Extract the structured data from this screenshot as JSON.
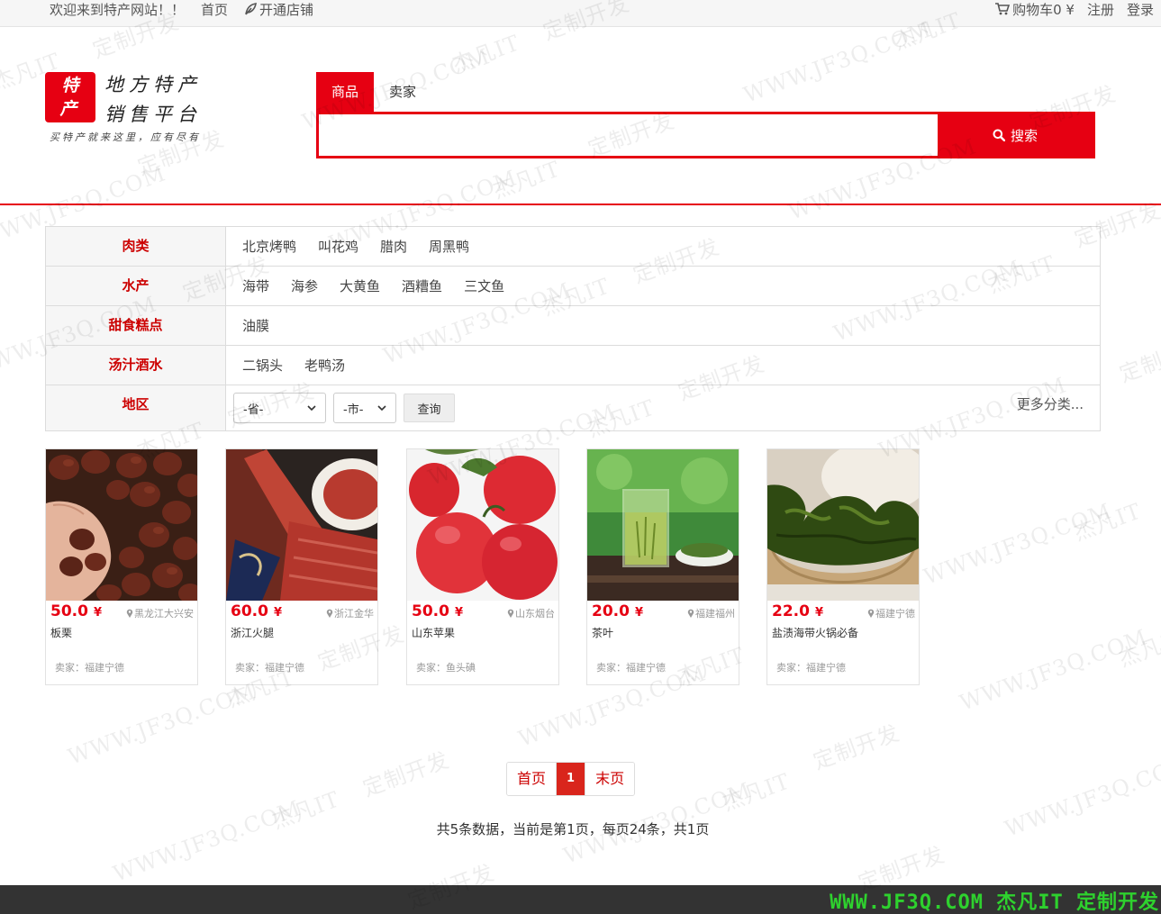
{
  "topbar": {
    "welcome": "欢迎来到特产网站！！",
    "home": "首页",
    "open_shop": "开通店铺",
    "cart": "购物车0 ¥",
    "register": "注册",
    "login": "登录"
  },
  "logo": {
    "char1": "特",
    "char2": "产",
    "line1": "地方特产",
    "line2": "销售平台",
    "slogan": "买特产就来这里，应有尽有"
  },
  "search": {
    "tabs": [
      "商品",
      "卖家"
    ],
    "active_tab": 0,
    "value": "",
    "button": "搜索"
  },
  "categories": [
    {
      "name": "肉类",
      "items": [
        "北京烤鸭",
        "叫花鸡",
        "腊肉",
        "周黑鸭"
      ]
    },
    {
      "name": "水产",
      "items": [
        "海带",
        "海参",
        "大黄鱼",
        "酒糟鱼",
        "三文鱼"
      ]
    },
    {
      "name": "甜食糕点",
      "items": [
        "油膜"
      ]
    },
    {
      "name": "汤汁酒水",
      "items": [
        "二锅头",
        "老鸭汤"
      ]
    }
  ],
  "region": {
    "label": "地区",
    "province": "-省-",
    "city": "-市-",
    "query": "查询",
    "more": "更多分类..."
  },
  "products": [
    {
      "price": "50.0",
      "currency": "¥",
      "location": "黑龙江大兴安",
      "name": "板栗",
      "seller": "卖家：福建宁德"
    },
    {
      "price": "60.0",
      "currency": "¥",
      "location": "浙江金华",
      "name": "浙江火腿",
      "seller": "卖家：福建宁德"
    },
    {
      "price": "50.0",
      "currency": "¥",
      "location": "山东烟台",
      "name": "山东苹果",
      "seller": "卖家：鱼头碘"
    },
    {
      "price": "20.0",
      "currency": "¥",
      "location": "福建福州",
      "name": "茶叶",
      "seller": "卖家：福建宁德"
    },
    {
      "price": "22.0",
      "currency": "¥",
      "location": "福建宁德",
      "name": "盐渍海带火锅必备",
      "seller": "卖家：福建宁德"
    }
  ],
  "pagination": {
    "first": "首页",
    "current": "1",
    "last": "末页",
    "info": "共5条数据，当前是第1页，每页24条，共1页"
  },
  "footer": {
    "text": "WWW.JF3Q.COM 杰凡IT  定制开发"
  },
  "watermark": {
    "site": "WWW.JF3Q.COM",
    "brand": "杰凡IT",
    "slogan": "定制开发"
  },
  "colors": {
    "primary_red": "#e60012",
    "footer_bg": "#333333",
    "footer_text": "#2ed12e"
  }
}
